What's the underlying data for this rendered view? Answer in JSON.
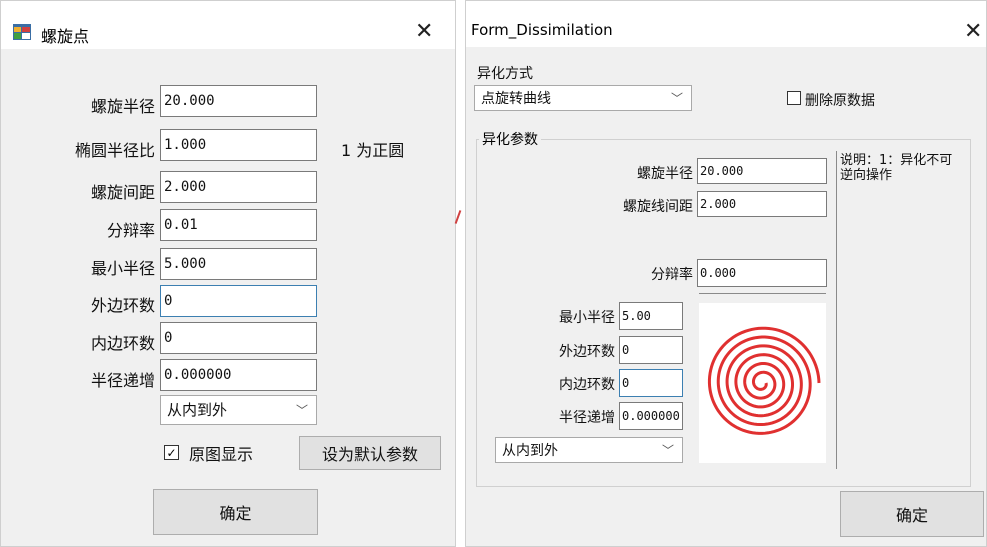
{
  "left_dialog": {
    "title": "螺旋点",
    "fields": [
      {
        "label": "螺旋半径",
        "value": "20.000"
      },
      {
        "label": "椭圆半径比",
        "value": "1.000"
      },
      {
        "label": "螺旋间距",
        "value": "2.000"
      },
      {
        "label": "分辩率",
        "value": "0.01"
      },
      {
        "label": "最小半径",
        "value": "5.000"
      },
      {
        "label": "外边环数",
        "value": "0"
      },
      {
        "label": "内边环数",
        "value": "0"
      },
      {
        "label": "半径递增",
        "value": "0.000000"
      }
    ],
    "ratio_note": "1 为正圆",
    "direction": "从内到外",
    "show_original_label": "原图显示",
    "show_original_checked": true,
    "set_default_label": "设为默认参数",
    "ok_label": "确定"
  },
  "right_dialog": {
    "title": "Form_Dissimilation",
    "mode_label": "异化方式",
    "mode_value": "点旋转曲线",
    "delete_label": "删除原数据",
    "delete_checked": false,
    "group_label": "异化参数",
    "spiral_radius_label": "螺旋半径",
    "spiral_radius_value": "20.000",
    "spiral_spacing_label": "螺旋线间距",
    "spiral_spacing_value": "2.000",
    "resolution_label": "分辩率",
    "resolution_value": "0.000",
    "min_radius_label": "最小半径",
    "min_radius_value": "5.00",
    "outer_rings_label": "外边环数",
    "outer_rings_value": "0",
    "inner_rings_label": "内边环数",
    "inner_rings_value": "0",
    "radius_inc_label": "半径递增",
    "radius_inc_value": "0.000000",
    "direction": "从内到外",
    "note": "说明：1：异化不可逆向操作",
    "ok_label": "确定",
    "preview_color": "#e03030"
  },
  "icons": {
    "app_icon": "app-window-icon",
    "close": "close-icon",
    "dropdown": "chevron-down-icon",
    "checkbox": "checkmark-icon"
  }
}
